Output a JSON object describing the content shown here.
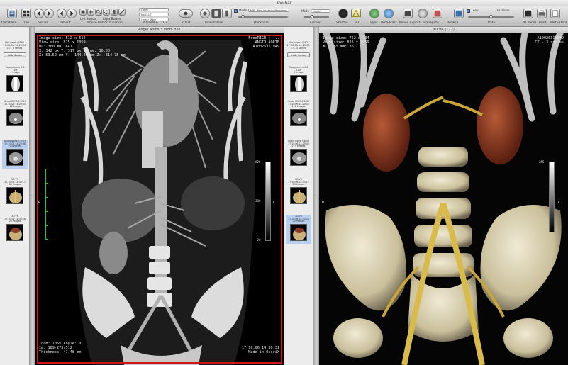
{
  "window": {
    "title": "Toolbar"
  },
  "toolbar": {
    "labels": [
      "Database",
      "Tile",
      "Series",
      "Patient",
      "Mouse button function",
      "WL/WW & CLUT",
      "2D/3D",
      "Orientation",
      "Thick Slab",
      "Cursor",
      "Shutter",
      "3D",
      "Sync",
      "Broadcast",
      "Movie Export",
      "Propagate",
      "Browse",
      "Rate",
      "3D Panel",
      "Print",
      "Meta-Data"
    ],
    "left_button": "Left Button",
    "right_button": "Right Button",
    "wl_ww_preset": "Other",
    "wl_ww_clut": "No CLUT",
    "opacity": "Linear Table",
    "mode": "Mode",
    "mode_value": "Linear",
    "mip_label": "Mode",
    "mip_value": "MIP - Max Intensity Projection",
    "loop_label": "Loop",
    "rate_value": "20.0 im/s"
  },
  "left_thumbs": {
    "header": [
      "Nasuwatu AMO",
      "17.10.06 14:29:30",
      "CT - 3 series"
    ],
    "hide_button": "Hide Series",
    "items": [
      {
        "caption": "Topogramme 0.6 T20f",
        "sub": "1 Image"
      },
      {
        "caption": "Acute IRC 3.0 B31f",
        "sub": "17.10.06 14:29:43",
        "sub2": "112 Images"
      },
      {
        "caption": "Angio Aorte 3 B31f",
        "sub": "17.10.06 14:29:48",
        "sub2": "273 Images"
      },
      {
        "caption": "3D VR",
        "sub": "17.10.06 14:30:17",
        "sub2": "89 Images"
      },
      {
        "caption": "3D VR",
        "sub": "17.10.06 14:30:28",
        "sub2": "20 Images"
      }
    ]
  },
  "right_thumbs": {
    "header": [
      "Nasuwatu AMO",
      "17.10.06 14:29:30",
      "CT - 3 series"
    ],
    "hide_button": "Hide Series",
    "items": [
      {
        "caption": "Topogramme 0.6 T20f",
        "sub": "1 Image"
      },
      {
        "caption": "Acute IRC 3.0 B31f",
        "sub": "17.10.06 14:29:43",
        "sub2": "112 Images"
      },
      {
        "caption": "Angio Aorte 3 B31f",
        "sub": "17.10.06 14:29:48",
        "sub2": "273 Images"
      },
      {
        "caption": "3D VR",
        "sub": "17.10.06 14:30:17",
        "sub2": "89 Images"
      },
      {
        "caption": "3D VR",
        "sub": "17.10.06 14:30:28",
        "sub2": "20 Images"
      }
    ]
  },
  "viewer_left": {
    "header": "Angio Aorte 3.0mm B31",
    "top_left": [
      "Image size: 512 x 512",
      "View size: 825 x 1059",
      "WL: 300 WW: 641",
      "X: 342 px Y: 317 px Value: 36.00",
      "X: 53.52 mm Y: -144.26 mm Z: -314.75 mm"
    ],
    "top_right": [
      "FreeRIGE | ...",
      "ANGIO_AORTE",
      "A10026311949"
    ],
    "bottom_left": [
      "Zoom: 105% Angle: 0",
      "Im: 189-273/512",
      "Thickness: 47.48 mm"
    ],
    "bottom_right": [
      "17.10.06 14:30:31",
      "Made in OsiriX"
    ],
    "lut_top": "620",
    "lut_mid": "300",
    "lut_bottom": "-20",
    "lut_side": "L",
    "side_marker": "R"
  },
  "viewer_right": {
    "header": "3D VR (112)",
    "top_left": [
      "Image size: 752 x 704",
      "View size: 825 x 1059",
      "WL: 255 WW: 361"
    ],
    "top_right": [
      "A10026311949",
      "CT - 3 series"
    ],
    "lut_top": "255",
    "lut_side": "L",
    "side_marker": "R"
  }
}
